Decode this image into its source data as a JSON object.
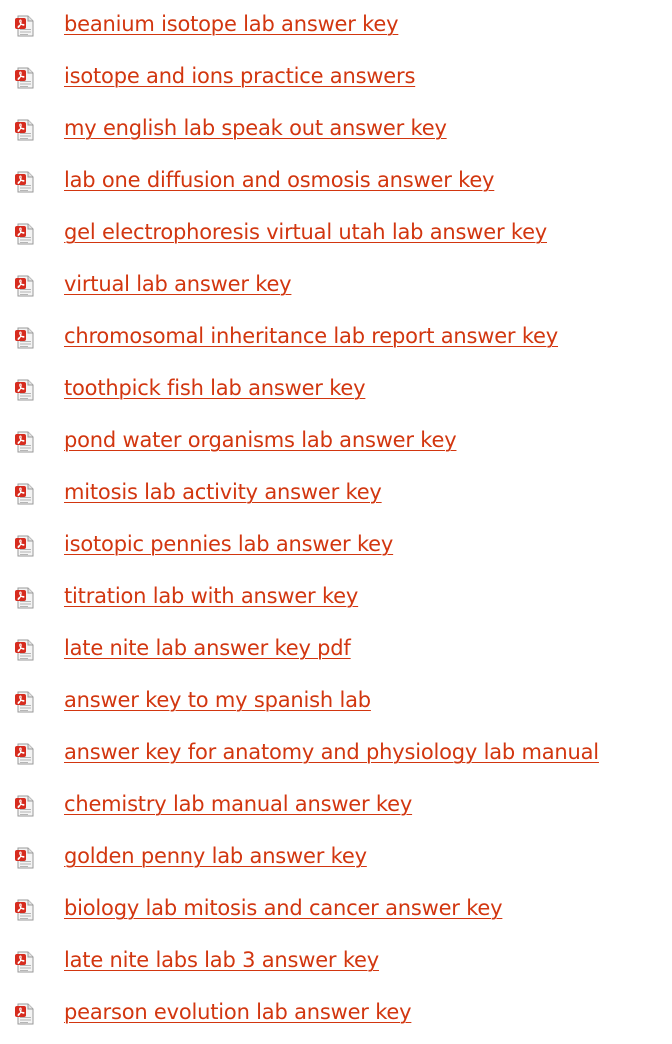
{
  "colors": {
    "link": "#d2360f",
    "icon_red": "#d62b1e",
    "icon_gray": "#9a9a9a"
  },
  "icon": "pdf-file-icon",
  "links": [
    {
      "label": "beanium isotope lab answer key"
    },
    {
      "label": "isotope and ions practice answers"
    },
    {
      "label": "my english lab speak out answer key"
    },
    {
      "label": "lab one diffusion and osmosis answer key"
    },
    {
      "label": "gel electrophoresis virtual utah lab answer key"
    },
    {
      "label": "virtual lab answer key"
    },
    {
      "label": "chromosomal inheritance lab report answer key"
    },
    {
      "label": "toothpick fish lab answer key"
    },
    {
      "label": "pond water organisms lab answer key"
    },
    {
      "label": "mitosis lab activity answer key"
    },
    {
      "label": "isotopic pennies lab answer key"
    },
    {
      "label": "titration lab with answer key"
    },
    {
      "label": "late nite lab answer key pdf"
    },
    {
      "label": "answer key to my spanish lab"
    },
    {
      "label": "answer key for anatomy and physiology lab manual"
    },
    {
      "label": "chemistry lab manual answer key"
    },
    {
      "label": "golden penny lab answer key"
    },
    {
      "label": "biology lab mitosis and cancer answer key"
    },
    {
      "label": "late nite labs lab 3 answer key"
    },
    {
      "label": "pearson evolution lab answer key"
    }
  ]
}
